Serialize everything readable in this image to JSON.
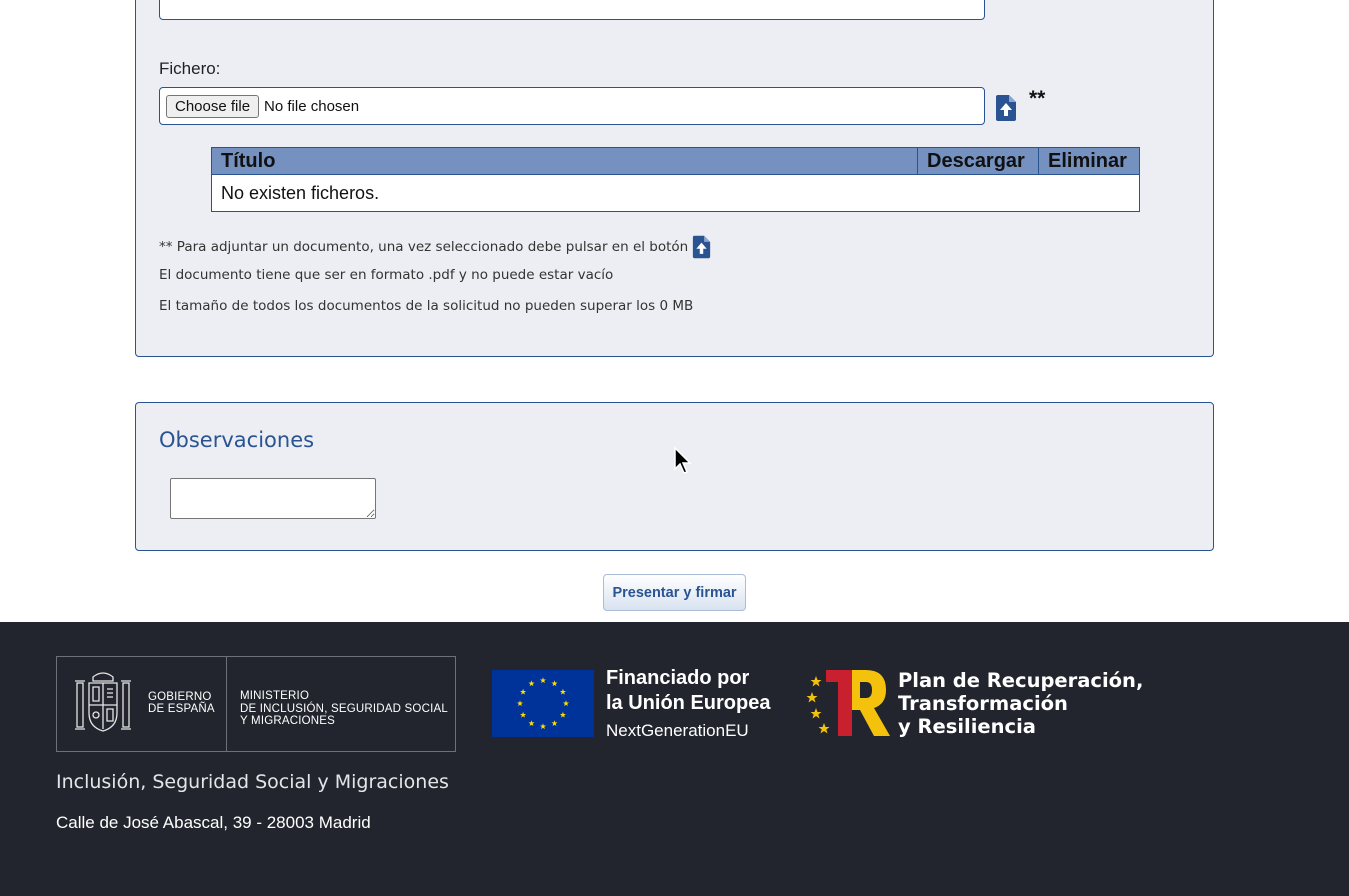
{
  "attachments": {
    "file_label": "Fichero:",
    "choose_file_button": "Choose file",
    "file_status": "No file chosen",
    "upload_icon": "file-upload-icon",
    "required_marker": "**",
    "table": {
      "headers": [
        "Título",
        "Descargar",
        "Eliminar"
      ],
      "empty_message": "No existen ficheros."
    },
    "notes": {
      "attach_hint": "** Para adjuntar un documento, una vez seleccionado debe pulsar en el botón",
      "format_hint": "El documento tiene que ser en formato .pdf y no puede estar vacío",
      "size_hint": "El tamaño de todos los documentos de la solicitud no pueden superar los 0 MB"
    }
  },
  "observations": {
    "title": "Observaciones",
    "textarea_value": ""
  },
  "actions": {
    "submit_label": "Presentar y firmar"
  },
  "footer": {
    "gov_name_line1": "GOBIERNO",
    "gov_name_line2": "DE ESPAÑA",
    "ministry_line1": "MINISTERIO",
    "ministry_line2": "DE INCLUSIÓN, SEGURIDAD SOCIAL",
    "ministry_line3": "Y MIGRACIONES",
    "eu_line1": "Financiado por",
    "eu_line2": "la Unión Europea",
    "eu_line3": "NextGenerationEU",
    "prtr_line1": "Plan de Recuperación,",
    "prtr_line2": "Transformación",
    "prtr_line3": "y Resiliencia",
    "ministry_name": "Inclusión, Seguridad Social y Migraciones",
    "address": "Calle de José Abascal, 39 - 28003 Madrid"
  },
  "colors": {
    "brand_blue": "#2a5491",
    "table_header": "#7591c0",
    "panel_bg": "#eceef3",
    "footer_bg": "#22252d",
    "eu_blue": "#003399",
    "eu_star": "#ffdd00",
    "prtr_red": "#c8202f",
    "prtr_yellow": "#f4c20d"
  }
}
